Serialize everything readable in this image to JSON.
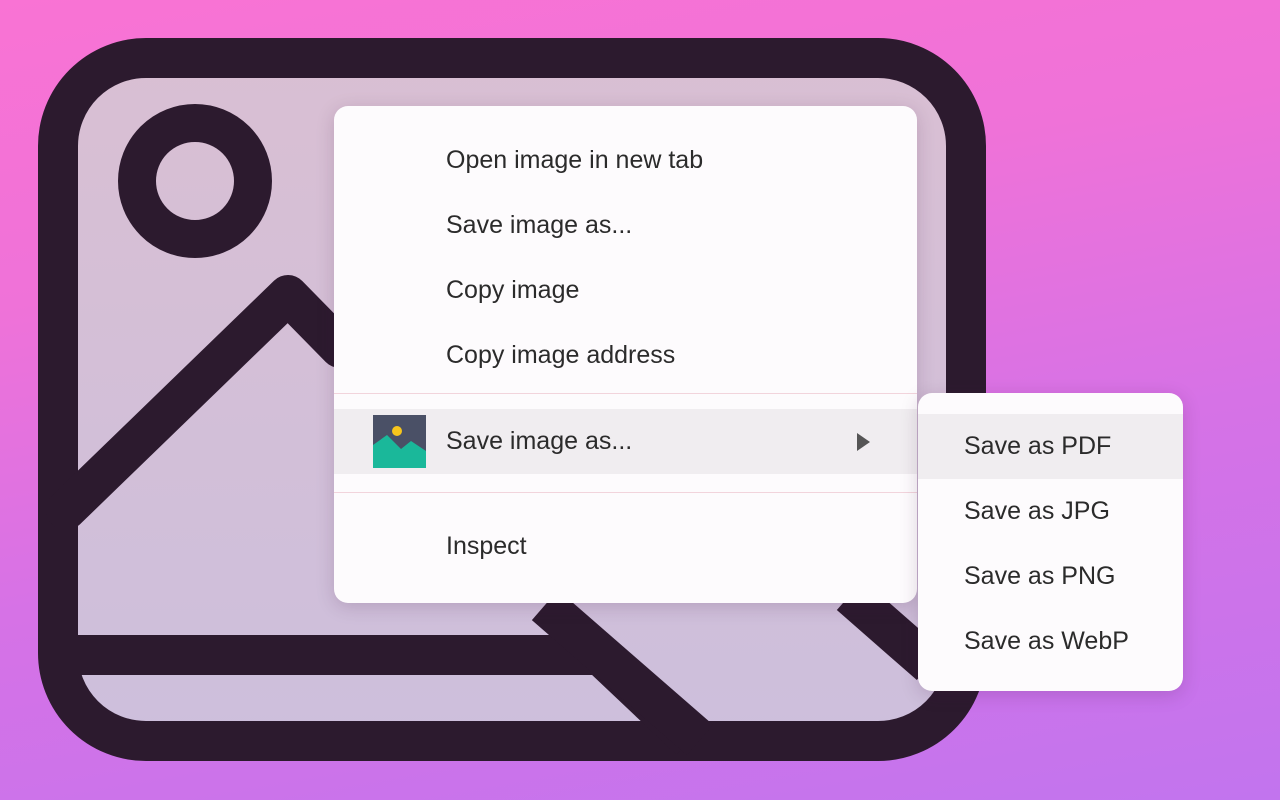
{
  "context_menu": {
    "items": [
      {
        "label": "Open image in new tab"
      },
      {
        "label": "Save image as..."
      },
      {
        "label": "Copy image"
      },
      {
        "label": "Copy image address"
      }
    ],
    "extension_item": {
      "label": "Save image as...",
      "icon": "image-landscape-icon",
      "has_submenu": true
    },
    "inspect_label": "Inspect"
  },
  "submenu": {
    "items": [
      {
        "label": "Save as PDF",
        "highlighted": true
      },
      {
        "label": "Save as JPG"
      },
      {
        "label": "Save as PNG"
      },
      {
        "label": "Save as WebP"
      }
    ]
  },
  "colors": {
    "background_top": "#f973d4",
    "background_bottom": "#c274ee",
    "illustration_stroke": "#2c1a2e",
    "illustration_fill": "#d7bed5",
    "menu_background": "#fdfbfd",
    "highlight": "#f0edf0",
    "icon_teal": "#1ab89a",
    "icon_sun": "#f7c51c",
    "icon_bg": "#4a5066"
  }
}
